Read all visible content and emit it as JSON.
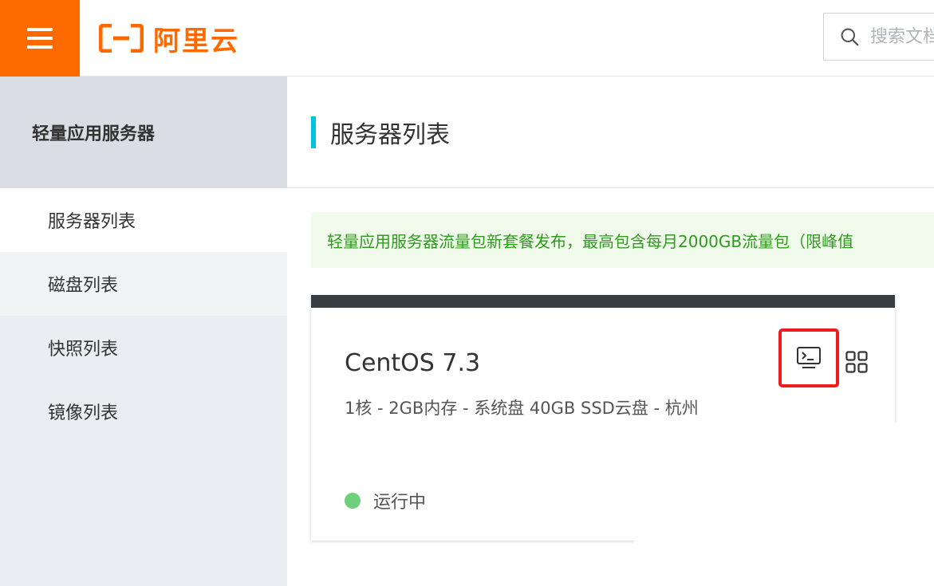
{
  "header": {
    "brand": "阿里云",
    "search_placeholder": "搜索文档"
  },
  "sidebar": {
    "title": "轻量应用服务器",
    "items": [
      {
        "label": "服务器列表"
      },
      {
        "label": "磁盘列表"
      },
      {
        "label": "快照列表"
      },
      {
        "label": "镜像列表"
      }
    ]
  },
  "main": {
    "page_title": "服务器列表",
    "notice": "轻量应用服务器流量包新套餐发布，最高包含每月2000GB流量包（限峰值",
    "card": {
      "os_name": "CentOS 7.3",
      "specs": "1核 - 2GB内存 - 系统盘 40GB SSD云盘 - 杭州",
      "status": "运行中"
    }
  },
  "colors": {
    "brand_orange": "#ff6a00",
    "accent_cyan": "#00c1de",
    "notice_green": "#2f9a1f",
    "status_green": "#6ed07a",
    "highlight_red": "#ee1c1c"
  },
  "icons": [
    "menu-icon",
    "aliyun-logo-icon",
    "search-icon",
    "terminal-icon",
    "grid-icon"
  ]
}
